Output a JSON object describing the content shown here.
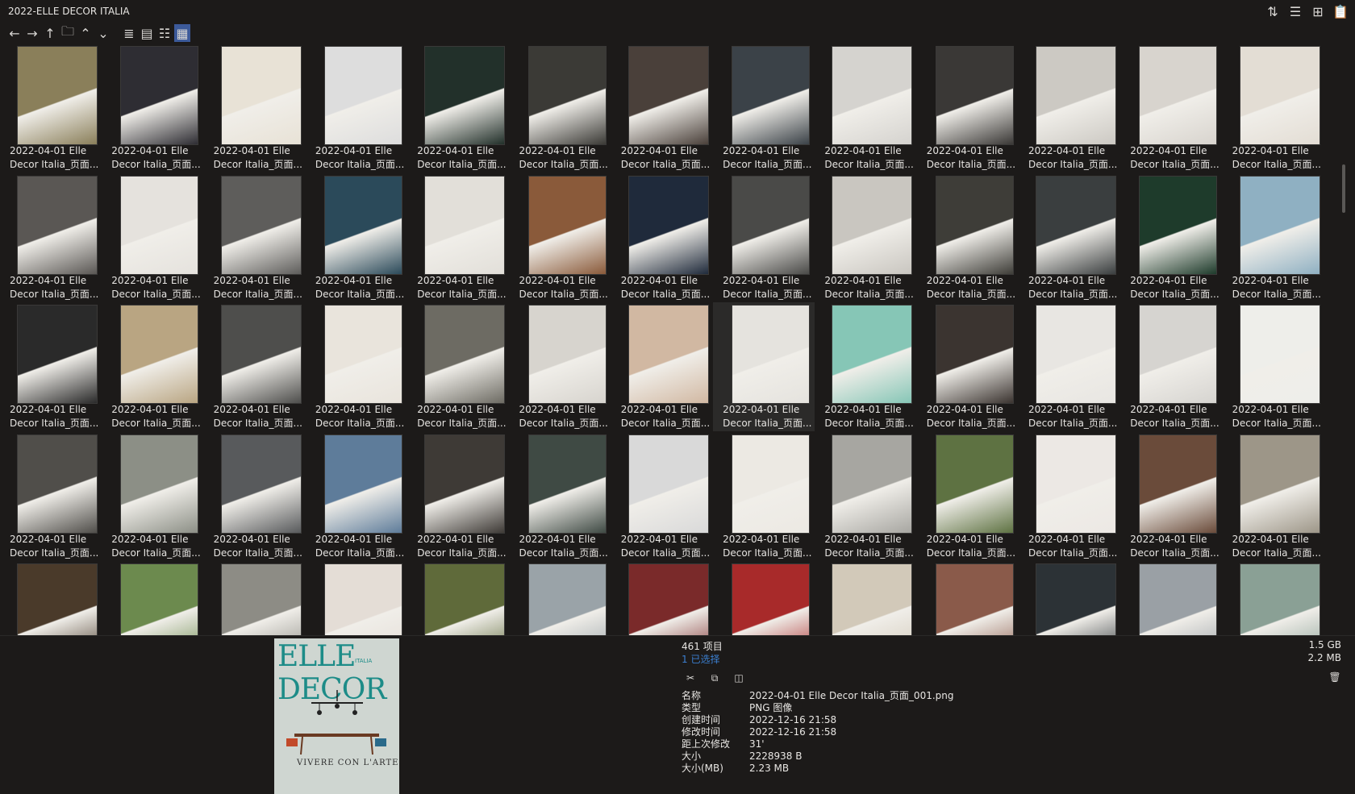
{
  "window": {
    "title": "2022-ELLE DECOR ITALIA"
  },
  "title_tools": [
    {
      "name": "sort-icon",
      "glyph": "⇅"
    },
    {
      "name": "details-icon",
      "glyph": "☰"
    },
    {
      "name": "new-window-icon",
      "glyph": "⊞"
    },
    {
      "name": "clipboard-icon",
      "glyph": "📋"
    }
  ],
  "toolbar": {
    "back": "←",
    "forward": "→",
    "up": "↑",
    "open_folder": "🗀",
    "chevron_up": "⌃",
    "chevron_down": "⌄",
    "view_list": "≣",
    "view_details": "▤",
    "view_tiles": "☷",
    "view_thumbnails": "▦"
  },
  "grid": {
    "line1": "2022-04-01 Elle",
    "line2": "Decor Italia_页面...",
    "rows": 5,
    "cols": 13,
    "selected_index": 33
  },
  "thumb_colors": [
    [
      "#8a7f5a",
      "#2e2d33",
      "#e8e2d6",
      "#ddd",
      "#22302a",
      "#3b3a36",
      "#4a403a",
      "#3b4248",
      "#d5d3cf",
      "#3a3836",
      "#ccc9c3",
      "#d8d4ce",
      "#e3ddd4"
    ],
    [
      "#5a5754",
      "#e5e2dd",
      "#5e5d5b",
      "#2b4a5a",
      "#e2dfd9",
      "#8a5a3a",
      "#1f2a3b",
      "#4a4a48",
      "#c9c6c0",
      "#3e3d38",
      "#3a3e3f",
      "#1e3b2b",
      "#8fb0c2"
    ],
    [
      "#2a2a2a",
      "#b9a582",
      "#4e4e4c",
      "#e9e4dc",
      "#6d6b63",
      "#d7d4ce",
      "#d1b8a2",
      "#e5e3de",
      "#86c6b6",
      "#3b3430",
      "#e8e6e2",
      "#d6d4d0",
      "#eeeeea"
    ],
    [
      "#504e4a",
      "#8c8f86",
      "#585a5c",
      "#5e7c9a",
      "#3e3a36",
      "#3f4a44",
      "#d9d9d9",
      "#ece9e3",
      "#a7a6a1",
      "#5e7242",
      "#ece8e4",
      "#6a4b3a",
      "#9d9688"
    ],
    [
      "#4a3a2a",
      "#6c8a4e",
      "#8d8c85",
      "#e4ddd6",
      "#5f6a3a",
      "#9aa3a8",
      "#7a2a2a",
      "#a82a2a",
      "#d2c9b9",
      "#8a5a4a",
      "#2c3236",
      "#9aa0a5",
      "#8aa095"
    ]
  ],
  "status": {
    "item_count": "461 项目",
    "selected": "1 已选择",
    "total_size": "1.5 GB",
    "selected_size": "2.2 MB"
  },
  "actions": {
    "cut": "✂",
    "copy": "⧉",
    "compare": "◫",
    "delete": "🗑"
  },
  "properties": [
    {
      "key": "名称",
      "value": "2022-04-01 Elle Decor Italia_页面_001.png"
    },
    {
      "key": "类型",
      "value": "PNG 图像"
    },
    {
      "key": "创建时间",
      "value": "2022-12-16  21:58"
    },
    {
      "key": "修改时间",
      "value": "2022-12-16  21:58"
    },
    {
      "key": "距上次修改",
      "value": "31'"
    },
    {
      "key": "大小",
      "value": "2228938 B"
    },
    {
      "key": "大小(MB)",
      "value": "2.23 MB"
    }
  ],
  "preview": {
    "brand": "ELLE DECOR",
    "edition": "ITALIA",
    "tagline": "VIVERE CON L'ARTE"
  }
}
